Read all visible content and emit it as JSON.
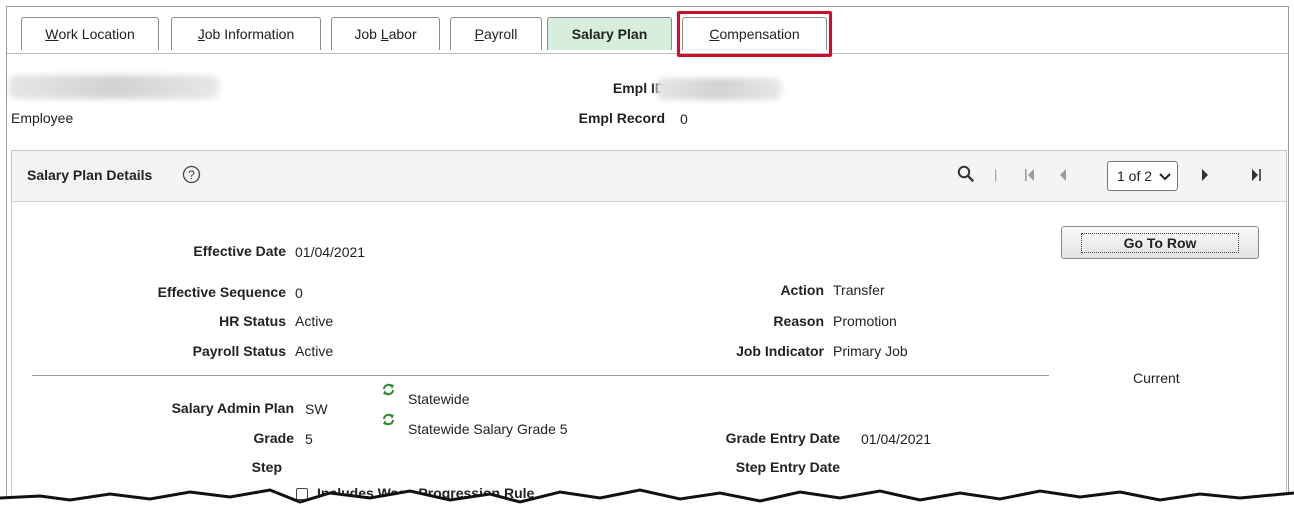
{
  "tabs": [
    {
      "label": "Work Location",
      "underline_char": "W",
      "rest": "ork Location"
    },
    {
      "label": "Job Information",
      "underline_char": "J",
      "rest": "ob Information"
    },
    {
      "label": "Job Labor",
      "pre": "Job ",
      "underline_char": "L",
      "rest": "abor"
    },
    {
      "label": "Payroll",
      "underline_char": "P",
      "rest": "ayroll"
    },
    {
      "label": "Salary Plan"
    },
    {
      "label": "Compensation",
      "underline_char": "C",
      "rest": "ompensation"
    }
  ],
  "header": {
    "employee_label": "Employee",
    "empl_id_label": "Empl ID",
    "empl_record_label": "Empl Record",
    "empl_record_value": "0"
  },
  "panel": {
    "title": "Salary Plan Details",
    "row_selector": "1 of 2",
    "go_to_row": "Go To Row",
    "current_label": "Current"
  },
  "fields": {
    "effective_date_label": "Effective Date",
    "effective_date_value": "01/04/2021",
    "effective_sequence_label": "Effective Sequence",
    "effective_sequence_value": "0",
    "hr_status_label": "HR Status",
    "hr_status_value": "Active",
    "payroll_status_label": "Payroll Status",
    "payroll_status_value": "Active",
    "action_label": "Action",
    "action_value": "Transfer",
    "reason_label": "Reason",
    "reason_value": "Promotion",
    "job_indicator_label": "Job Indicator",
    "job_indicator_value": "Primary Job",
    "salary_admin_plan_label": "Salary Admin Plan",
    "salary_admin_plan_value": "SW",
    "salary_admin_plan_desc": "Statewide",
    "grade_label": "Grade",
    "grade_value": "5",
    "grade_desc": "Statewide Salary Grade 5",
    "step_label": "Step",
    "grade_entry_date_label": "Grade Entry Date",
    "grade_entry_date_value": "01/04/2021",
    "step_entry_date_label": "Step Entry Date",
    "wage_progression_label": "Includes Wage Progression Rule"
  },
  "colors": {
    "active_tab": "#d7eedc",
    "highlight": "#c8102e",
    "refresh_icon": "#2e8b2e"
  }
}
